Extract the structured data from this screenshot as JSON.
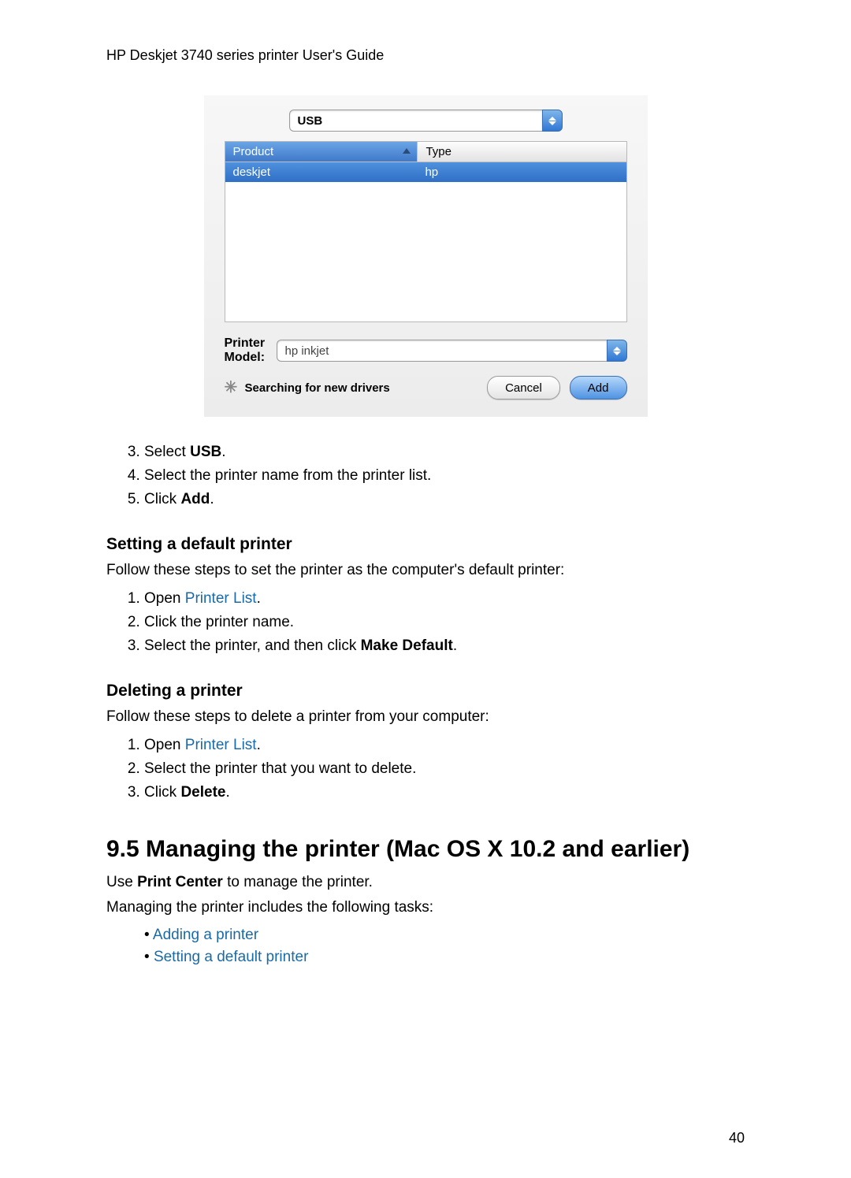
{
  "header": {
    "title": "HP Deskjet 3740 series printer User's Guide"
  },
  "dialog": {
    "connection_type": "USB",
    "table": {
      "col_product": "Product",
      "col_type": "Type",
      "rows": [
        {
          "product": "deskjet",
          "type": "hp"
        }
      ]
    },
    "printer_model_label": "Printer Model:",
    "printer_model_value": "hp inkjet",
    "status_text": "Searching for new drivers",
    "cancel_label": "Cancel",
    "add_label": "Add"
  },
  "steps_first": {
    "s3a": "Select ",
    "s3b": "USB",
    "s3c": ".",
    "s4": "Select the printer name from the printer list.",
    "s5a": "Click ",
    "s5b": "Add",
    "s5c": "."
  },
  "section_default": {
    "heading": "Setting a default printer",
    "intro": "Follow these steps to set the printer as the computer's default printer:",
    "s1a": "Open ",
    "s1b": "Printer List",
    "s1c": ".",
    "s2": "Click the printer name.",
    "s3a": "Select the printer, and then click ",
    "s3b": "Make Default",
    "s3c": "."
  },
  "section_delete": {
    "heading": "Deleting a printer",
    "intro": "Follow these steps to delete a printer from your computer:",
    "s1a": "Open ",
    "s1b": "Printer List",
    "s1c": ".",
    "s2": "Select the printer that you want to delete.",
    "s3a": "Click ",
    "s3b": "Delete",
    "s3c": "."
  },
  "section_9_5": {
    "heading": "9.5 Managing the printer (Mac OS X 10.2 and earlier)",
    "line1a": "Use ",
    "line1b": "Print Center",
    "line1c": " to manage the printer.",
    "line2": "Managing the printer includes the following tasks:",
    "bullet1": "Adding a printer",
    "bullet2": "Setting a default printer"
  },
  "page_number": "40"
}
